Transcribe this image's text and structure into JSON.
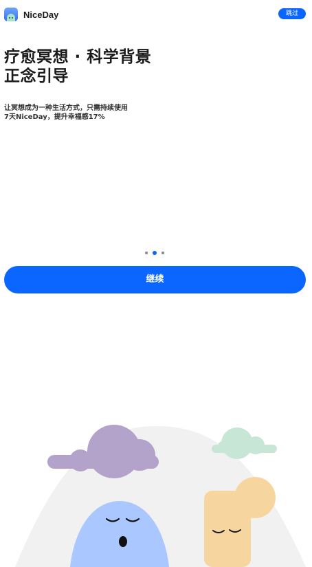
{
  "header": {
    "app_name": "NiceDay",
    "skip_label": "跳过"
  },
  "headline": {
    "line1": "疗愈冥想 · 科学背景",
    "line2": "正念引导"
  },
  "subtext": {
    "line1": "让冥想成为一种生活方式，只需持续使用",
    "line2": "7天NiceDay，提升幸福感17%"
  },
  "pager": {
    "count": 3,
    "active_index": 1
  },
  "continue_label": "继续",
  "colors": {
    "accent": "#0a66ff",
    "cloud_purple": "#b3a2c9",
    "cloud_green": "#c8e6d6",
    "character_blue": "#aac7ff",
    "character_orange": "#f7d59f",
    "hill": "#f1f1f1"
  },
  "icons": {
    "app": "niceday-app-icon"
  }
}
